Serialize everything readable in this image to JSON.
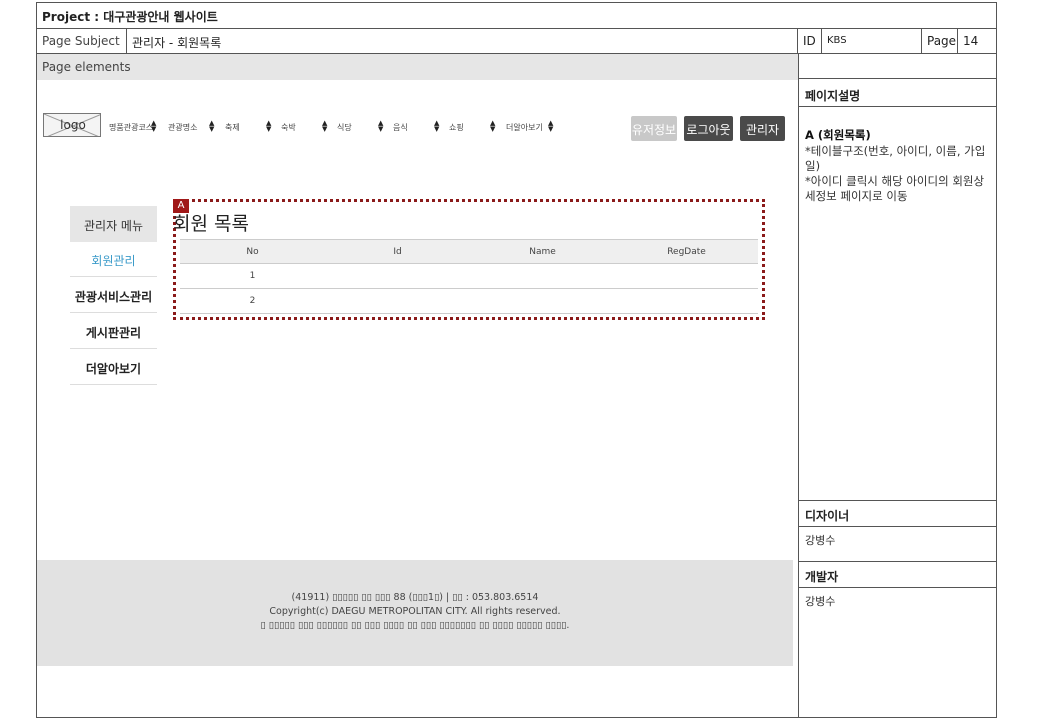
{
  "project": {
    "label": "Project : 대구관광안내 웹사이트"
  },
  "subject": {
    "label": "Page Subject",
    "value": "관리자 - 회원목록",
    "id_label": "ID",
    "id_value": "KBS",
    "page_label": "Page",
    "page_value": "14"
  },
  "elements_label": "Page elements",
  "right_panel": {
    "desc_title": "페이지설명",
    "desc_a_title": "A (회원목록)",
    "desc_lines": [
      "*테이블구조(번호, 아이디, 이름, 가입일)",
      "*아이디 클릭시 해당 아이디의 회원상세정보 페이지로 이동"
    ],
    "designer_title": "디자이너",
    "designer_name": "강병수",
    "developer_title": "개발자",
    "developer_name": "강병수"
  },
  "header": {
    "logo": "logo",
    "menus": [
      "명품관광코스",
      "관광명소",
      "축제",
      "숙박",
      "식당",
      "음식",
      "쇼핑",
      "더알아보기"
    ],
    "buttons": {
      "userinfo": "유저정보",
      "logout": "로그아웃",
      "admin": "관리자"
    }
  },
  "sidebar": {
    "title": "관리자 메뉴",
    "items": [
      "회원관리",
      "관광서비스관리",
      "게시판관리",
      "더알아보기"
    ]
  },
  "main": {
    "marker": "A",
    "title": "회원 목록",
    "columns": [
      "No",
      "Id",
      "Name",
      "RegDate"
    ],
    "rows": [
      [
        "1",
        "",
        "",
        ""
      ],
      [
        "2",
        "",
        "",
        ""
      ]
    ]
  },
  "footer": {
    "line1": "(41911) ▯▯▯▯▯ ▯▯ ▯▯▯ 88 (▯▯▯1▯) | ▯▯ : 053.803.6514",
    "line2": "Copyright(c) DAEGU METROPOLITAN CITY. All rights reserved.",
    "line3": "▯ ▯▯▯▯▯ ▯▯▯ ▯▯▯▯▯▯ ▯▯ ▯▯▯ ▯▯▯▯ ▯▯ ▯▯▯ ▯▯▯▯▯▯▯ ▯▯ ▯▯▯▯ ▯▯▯▯▯ ▯▯▯▯."
  }
}
